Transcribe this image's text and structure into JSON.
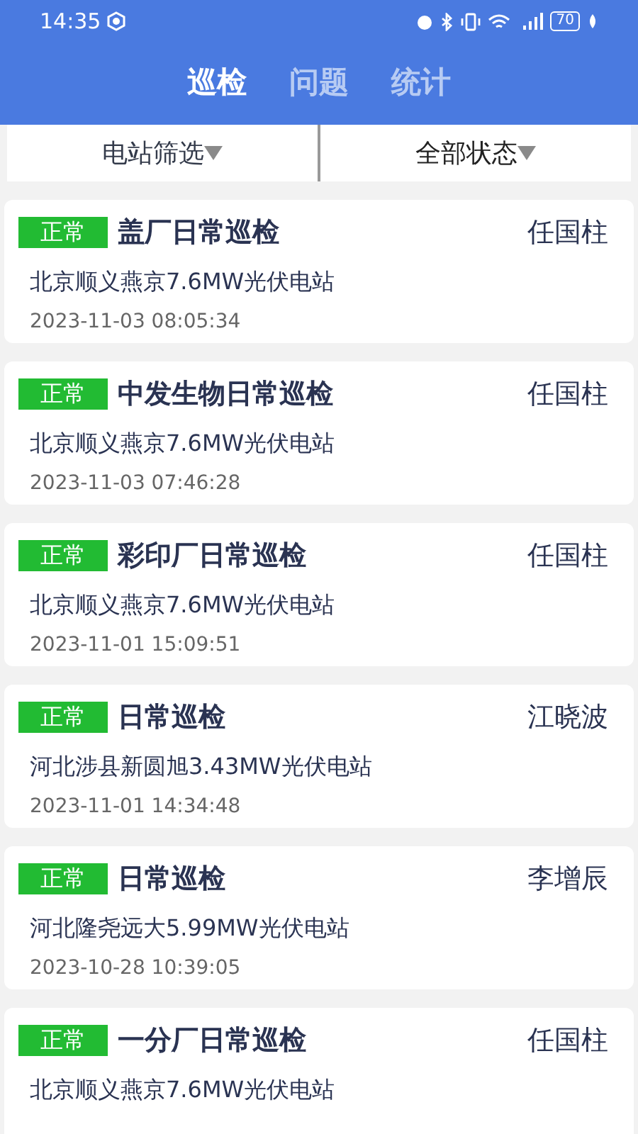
{
  "status_bar": {
    "time": "14:35",
    "battery": "70"
  },
  "tabs": [
    {
      "label": "巡检",
      "selected": true
    },
    {
      "label": "问题",
      "selected": false
    },
    {
      "label": "统计",
      "selected": false
    }
  ],
  "filters": [
    {
      "label": "电站筛选"
    },
    {
      "label": "全部状态"
    }
  ],
  "records": [
    {
      "status": "正常",
      "title": "盖厂日常巡检",
      "person": "任国柱",
      "station": "北京顺义燕京7.6MW光伏电站",
      "time": "2023-11-03 08:05:34"
    },
    {
      "status": "正常",
      "title": "中发生物日常巡检",
      "person": "任国柱",
      "station": "北京顺义燕京7.6MW光伏电站",
      "time": "2023-11-03 07:46:28"
    },
    {
      "status": "正常",
      "title": "彩印厂日常巡检",
      "person": "任国柱",
      "station": "北京顺义燕京7.6MW光伏电站",
      "time": "2023-11-01 15:09:51"
    },
    {
      "status": "正常",
      "title": "日常巡检",
      "person": "江晓波",
      "station": "河北涉县新圆旭3.43MW光伏电站",
      "time": "2023-11-01 14:34:48"
    },
    {
      "status": "正常",
      "title": "日常巡检",
      "person": "李增辰",
      "station": "河北隆尧远大5.99MW光伏电站",
      "time": "2023-10-28 10:39:05"
    },
    {
      "status": "正常",
      "title": "一分厂日常巡检",
      "person": "任国柱",
      "station": "北京顺义燕京7.6MW光伏电站"
    }
  ]
}
